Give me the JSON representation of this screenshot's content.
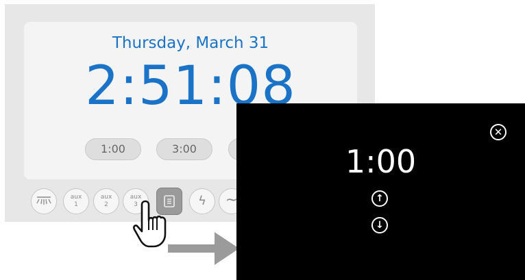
{
  "clock": {
    "date": "Thursday, March 31",
    "time": "2:51:08"
  },
  "presets": [
    "1:00",
    "3:00"
  ],
  "controls": {
    "aux1": [
      "aux",
      "1"
    ],
    "aux2": [
      "aux",
      "2"
    ],
    "aux3": [
      "aux",
      "3"
    ],
    "lightning_glyph": "ϟ",
    "wave_glyph": "~"
  },
  "timer_dialog": {
    "value": "1:00",
    "close_glyph": "✕",
    "up_glyph": "↑",
    "down_glyph": "↓"
  },
  "colors": {
    "accent": "#1a73c7",
    "device_bg": "#e7e7e7",
    "screen_bg": "#f4f4f4",
    "overlay_bg": "#000000",
    "arrow": "#9b9b9b"
  },
  "icons": [
    "light-icon",
    "timer-icon",
    "lightning-icon",
    "wave-icon",
    "hand-pointer-icon",
    "arrow-right-icon",
    "close-icon",
    "arrow-up-icon",
    "arrow-down-icon"
  ]
}
